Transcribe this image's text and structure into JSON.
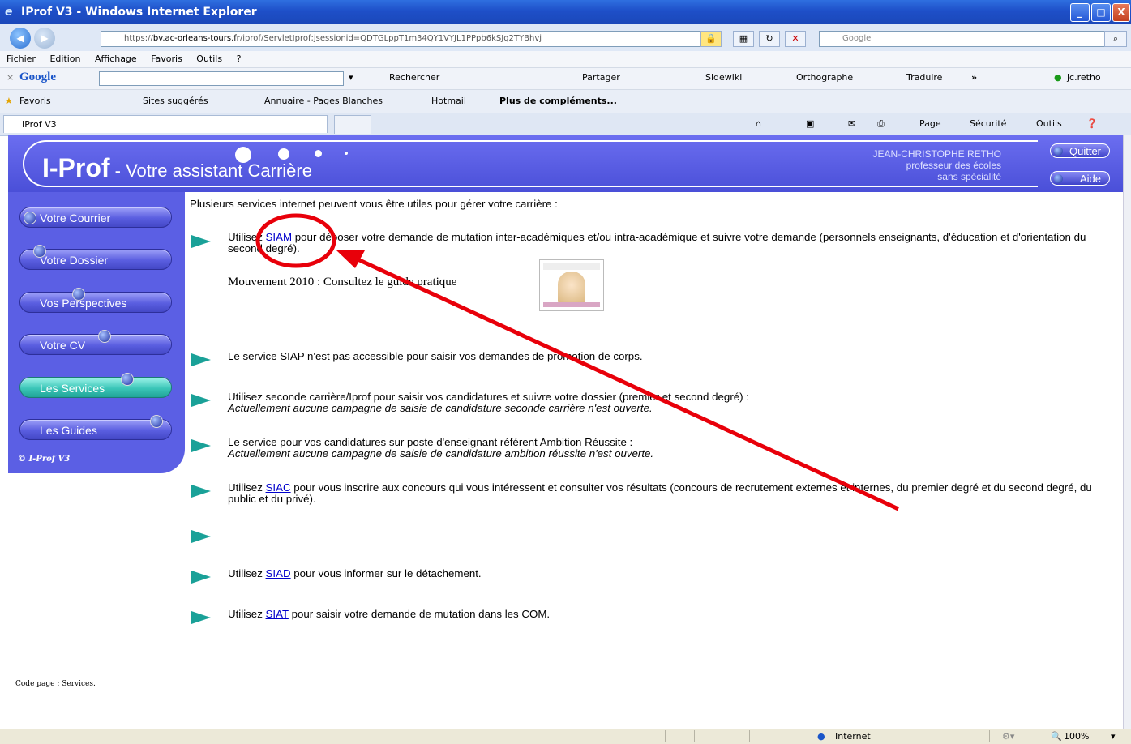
{
  "window": {
    "title": "IProf V3 - Windows Internet Explorer",
    "buttons": {
      "minimize": "_",
      "maximize": "□",
      "close": "X"
    }
  },
  "address_bar": {
    "url_prefix": "https://",
    "url_domain": "bv.ac-orleans-tours.fr",
    "url_rest": "/iprof/ServletIprof;jsessionid=QDTGLppT1m34QY1VYJL1PPpb6kSJq2TYBhvj",
    "search_placeholder": "Google",
    "search_button": "⌕"
  },
  "menu": [
    "Fichier",
    "Edition",
    "Affichage",
    "Favoris",
    "Outils",
    "?"
  ],
  "google_toolbar": {
    "logo": "Google",
    "items": [
      "Rechercher",
      "Partager",
      "Sidewiki",
      "Orthographe",
      "Traduire",
      "»",
      "jc.retho"
    ]
  },
  "favorites_bar": {
    "favorites": "Favoris",
    "items": [
      "Sites suggérés",
      "Annuaire - Pages Blanches",
      "Hotmail",
      "Plus de compléments..."
    ]
  },
  "tab": {
    "title": "IProf V3"
  },
  "command_bar": [
    "Page",
    "Sécurité",
    "Outils"
  ],
  "header": {
    "brand": "I-Prof",
    "subtitle": " - Votre assistant Carrière",
    "user_name": "JEAN-CHRISTOPHE RETHO",
    "user_role_1": "professeur des écoles",
    "user_role_2": "sans spécialité",
    "quit": "Quitter",
    "help": "Aide"
  },
  "sidebar": {
    "items": [
      {
        "label": "Votre Courrier"
      },
      {
        "label": "Votre Dossier"
      },
      {
        "label": "Vos Perspectives"
      },
      {
        "label": "Votre CV"
      },
      {
        "label": "Les Services"
      },
      {
        "label": "Les Guides"
      }
    ],
    "copyright": "© I-Prof V3"
  },
  "content": {
    "intro": "Plusieurs services internet peuvent vous être utiles pour gérer votre carrière :",
    "siam_pre": "Utilisez ",
    "siam_link": "SIAM",
    "siam_post": " pour déposer votre demande de mutation inter-académiques et/ou intra-académique et suivre votre demande (personnels enseignants, d'éducation et d'orientation du second degré).",
    "mouvement": "Mouvement 2010 : Consultez le guide pratique",
    "siap": "Le service SIAP n'est pas accessible pour saisir vos demandes de promotion de corps.",
    "seconde_1": "Utilisez seconde carrière/Iprof pour saisir vos candidatures et suivre votre dossier (premier et second degré) :",
    "seconde_2": "Actuellement aucune campagne de saisie de candidature seconde carrière n'est ouverte.",
    "ambition_1": "Le service pour vos candidatures sur poste d'enseignant référent Ambition Réussite :",
    "ambition_2": "Actuellement aucune campagne de saisie de candidature ambition réussite n'est ouverte.",
    "siac_pre": "Utilisez ",
    "siac_link": "SIAC",
    "siac_post": " pour vous inscrire aux concours qui vous intéressent et consulter vos résultats (concours de recrutement externes et internes, du premier degré et du second degré, du public et du privé).",
    "siad_pre": "Utilisez ",
    "siad_link": "SIAD",
    "siad_post": " pour vous informer sur le détachement.",
    "siat_pre": "Utilisez ",
    "siat_link": "SIAT",
    "siat_post": " pour saisir votre demande de mutation dans les COM.",
    "code_page": "Code page : Services."
  },
  "status_bar": {
    "zone": "Internet",
    "zoom": "100%"
  },
  "colors": {
    "header": "#5b5fe4",
    "active_nav": "#3bc6b8",
    "bullet": "#1aa198",
    "annotation": "#e8000a"
  }
}
